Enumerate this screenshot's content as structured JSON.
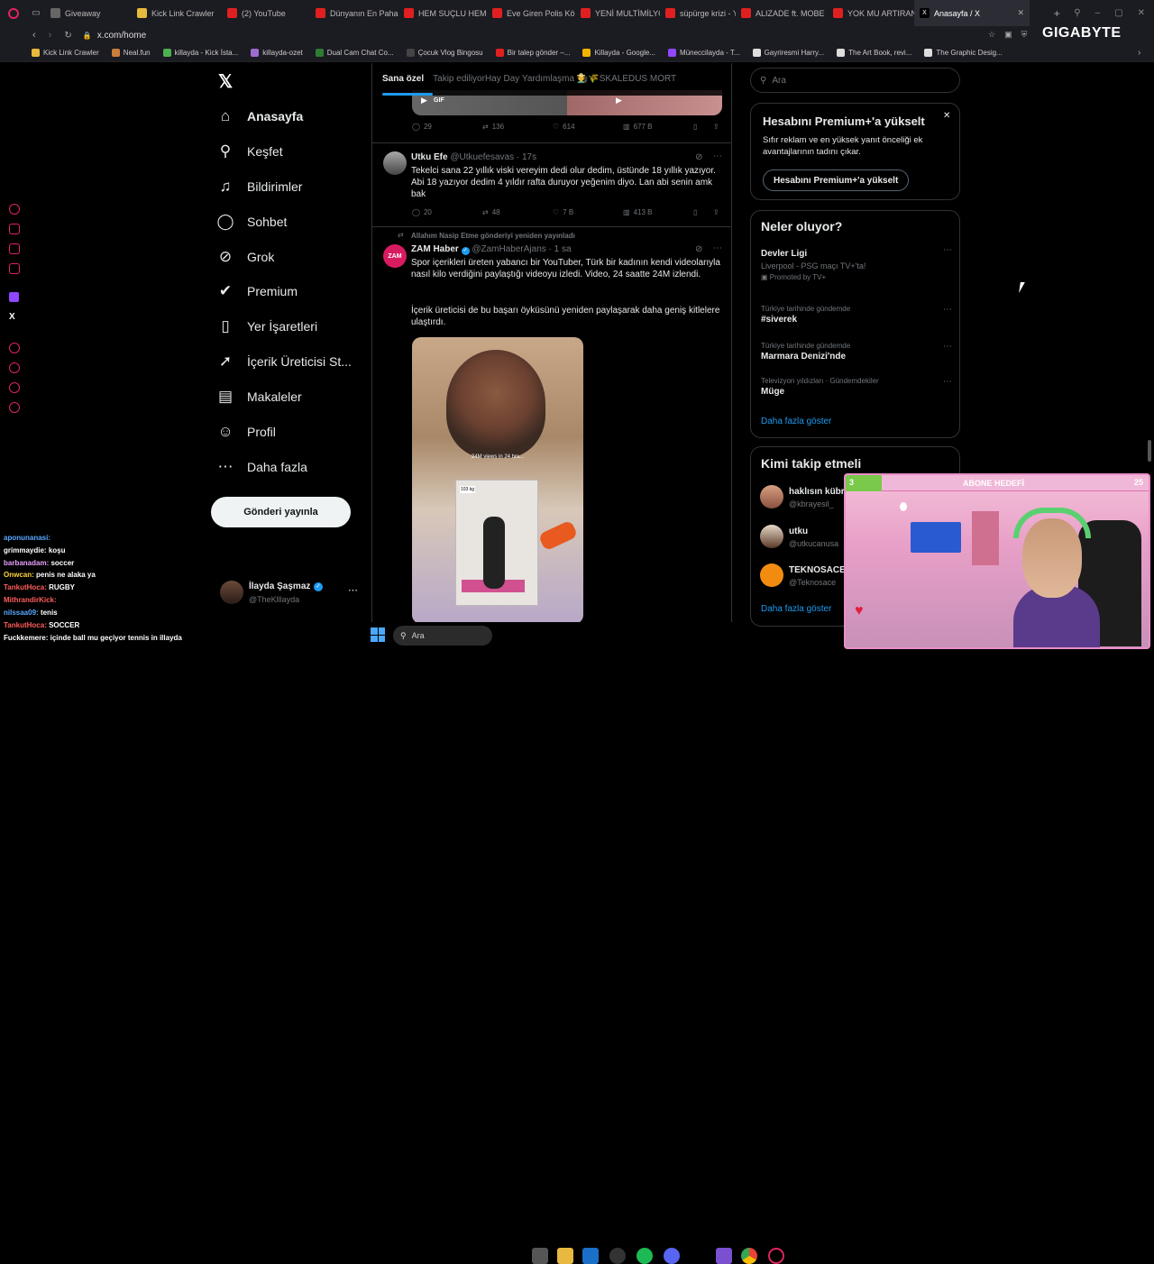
{
  "browser": {
    "tabs": [
      {
        "label": "Giveaway",
        "color": "#666"
      },
      {
        "label": "Kick Link Crawler",
        "color": "#e8b93a"
      },
      {
        "label": "(2) YouTube",
        "color": "#e02020"
      },
      {
        "label": "Dünyanın En Pahalı",
        "color": "#e02020"
      },
      {
        "label": "HEM SUÇLU HEM",
        "color": "#e02020"
      },
      {
        "label": "Eve Giren Polis Kö",
        "color": "#e02020"
      },
      {
        "label": "YENİ MULTİMİLYO",
        "color": "#e02020"
      },
      {
        "label": "süpürge krizi - You",
        "color": "#e02020"
      },
      {
        "label": "ALIZADE ft. MOBE",
        "color": "#e02020"
      },
      {
        "label": "YOK MU ARTIRAN",
        "color": "#e02020"
      },
      {
        "label": "Anasayfa / X",
        "color": "#000"
      }
    ],
    "url": "x.com/home",
    "bookmarks": [
      {
        "label": "Kick Link Crawler",
        "color": "#e8b93a"
      },
      {
        "label": "Neal.fun",
        "color": "#c87e3c"
      },
      {
        "label": "killayda - Kick İsta...",
        "color": "#4caf50"
      },
      {
        "label": "killayda-ozet",
        "color": "#9c6cd0"
      },
      {
        "label": "Dual Cam Chat Co...",
        "color": "#2e7d32"
      },
      {
        "label": "Çocuk Vlog Bingosu",
        "color": "#444"
      },
      {
        "label": "Bir talep gönder –...",
        "color": "#e02020"
      },
      {
        "label": "Killayda - Google...",
        "color": "#f4b400"
      },
      {
        "label": "Müneccilayda - T...",
        "color": "#9146ff"
      },
      {
        "label": "Gayriresmi Harry...",
        "color": "#ddd"
      },
      {
        "label": "The Art Book, revi...",
        "color": "#ddd"
      },
      {
        "label": "The Graphic Desig...",
        "color": "#ddd"
      }
    ],
    "watermark": "GIGABYTE"
  },
  "nav": {
    "items": [
      {
        "label": "Anasayfa",
        "icon": "home-icon",
        "glyph": "⌂"
      },
      {
        "label": "Keşfet",
        "icon": "search-icon",
        "glyph": "⚲"
      },
      {
        "label": "Bildirimler",
        "icon": "bell-icon",
        "glyph": "♫"
      },
      {
        "label": "Sohbet",
        "icon": "chat-icon",
        "glyph": "◯"
      },
      {
        "label": "Grok",
        "icon": "grok-icon",
        "glyph": "⊘"
      },
      {
        "label": "Premium",
        "icon": "premium-icon",
        "glyph": "✔"
      },
      {
        "label": "Yer İşaretleri",
        "icon": "bookmark-icon",
        "glyph": "▯"
      },
      {
        "label": "İçerik Üreticisi St...",
        "icon": "rocket-icon",
        "glyph": "➚"
      },
      {
        "label": "Makaleler",
        "icon": "articles-icon",
        "glyph": "▤"
      },
      {
        "label": "Profil",
        "icon": "profile-icon",
        "glyph": "☺"
      },
      {
        "label": "Daha fazla",
        "icon": "more-icon",
        "glyph": "⋯"
      }
    ],
    "post_button": "Gönderi yayınla",
    "account_name": "İlayda Şaşmaz",
    "account_handle": "@TheKlllayda"
  },
  "feed": {
    "tabs": [
      "Sana özel",
      "Takip ediliyor",
      "Hay Day Yardımlaşma 🧑‍🌾🌾",
      "SKALEDUS MORT"
    ],
    "gif_label": "GIF",
    "tweet0_stats": {
      "replies": "29",
      "reposts": "136",
      "likes": "614",
      "views": "677 B"
    },
    "tweet1": {
      "name": "Utku Efe",
      "handle": "@Utkuefesavas",
      "time": "· 17s",
      "text": "Tekelci sana 22 yıllık viski vereyim dedi olur dedim, üstünde 18 yıllık yazıyor. Abi 18 yazıyor dedim 4 yıldır rafta duruyor yeğenim diyo. Lan abi senin amk bak",
      "replies": "20",
      "reposts": "48",
      "likes": "7 B",
      "views": "413 B"
    },
    "tweet2": {
      "repost_note": "Allahım Nasip Etme gönderiyi yeniden yayınladı",
      "avatar_text": "ZAM",
      "name": "ZAM Haber",
      "handle": "@ZamHaberAjans",
      "time": "· 1 sa",
      "text1": "Spor içerikleri üreten yabancı bir YouTuber, Türk bir kadının kendi videolarıyla nasıl kilo verdiğini paylaştığı videoyu izledi. Video, 24 saatte 24M izlendi.",
      "text2": "İçerik üreticisi de bu başarı öyküsünü yeniden paylaşarak daha geniş kitlelere ulaştırdı.",
      "video_caption": "24M views in 24 hrs...",
      "video_weight": "103 kg"
    }
  },
  "right": {
    "search_placeholder": "Ara",
    "premium_title": "Hesabını Premium+'a yükselt",
    "premium_desc": "Sıfır reklam ve en yüksek yanıt önceliği ek avantajlarının tadını çıkar.",
    "premium_button": "Hesabını Premium+'a yükselt",
    "trends_title": "Neler oluyor?",
    "trends": [
      {
        "category": "",
        "name": "Devler Ligi",
        "sub": "Liverpool - PSG maçı TV+'ta!",
        "promo": "Promoted by TV+"
      },
      {
        "category": "Türkiye tarihinde gündemde",
        "name": "#siverek",
        "sub": "",
        "promo": ""
      },
      {
        "category": "Türkiye tarihinde gündemde",
        "name": "Marmara Denizi'nde",
        "sub": "",
        "promo": ""
      },
      {
        "category": "Televizyon yıldızları · Gündemdekiler",
        "name": "Müge",
        "sub": "",
        "promo": ""
      }
    ],
    "show_more": "Daha fazla göster",
    "follow_title": "Kimi takip etmeli",
    "follow": [
      {
        "name": "haklısın kübr",
        "handle": "@kbrayesil_"
      },
      {
        "name": "utku",
        "handle": "@utkucanusa"
      },
      {
        "name": "TEKNOSACE",
        "handle": "@Teknosace"
      }
    ],
    "follow_more": "Daha fazla göster"
  },
  "stream": {
    "goal_label": "ABONE HEDEFİ",
    "goal_current": "3",
    "goal_target": "25",
    "goal_progress": 0.12,
    "chat": [
      {
        "user": "aponunanasi:",
        "msg": "",
        "color": "#5aa9ff"
      },
      {
        "user": "grimmaydie:",
        "msg": "koşu",
        "color": "#ffffff"
      },
      {
        "user": "barbanadam:",
        "msg": "soccer",
        "color": "#e8a0ff"
      },
      {
        "user": "Onwcan:",
        "msg": "penis ne alaka ya",
        "color": "#ffd23f"
      },
      {
        "user": "TankutHoca:",
        "msg": "RUGBY",
        "color": "#ff5c5c"
      },
      {
        "user": "MithrandirKick:",
        "msg": "",
        "color": "#ff5c5c"
      },
      {
        "user": "nilssaa09:",
        "msg": "tenis",
        "color": "#5aa9ff"
      },
      {
        "user": "TankutHoca:",
        "msg": "SOCCER",
        "color": "#ff5c5c"
      },
      {
        "user": "Fuckkemere:",
        "msg": "içinde ball mu geçiyor tennis in illayda",
        "color": "#ffffff"
      }
    ]
  },
  "taskbar": {
    "search_placeholder": "Ara"
  }
}
